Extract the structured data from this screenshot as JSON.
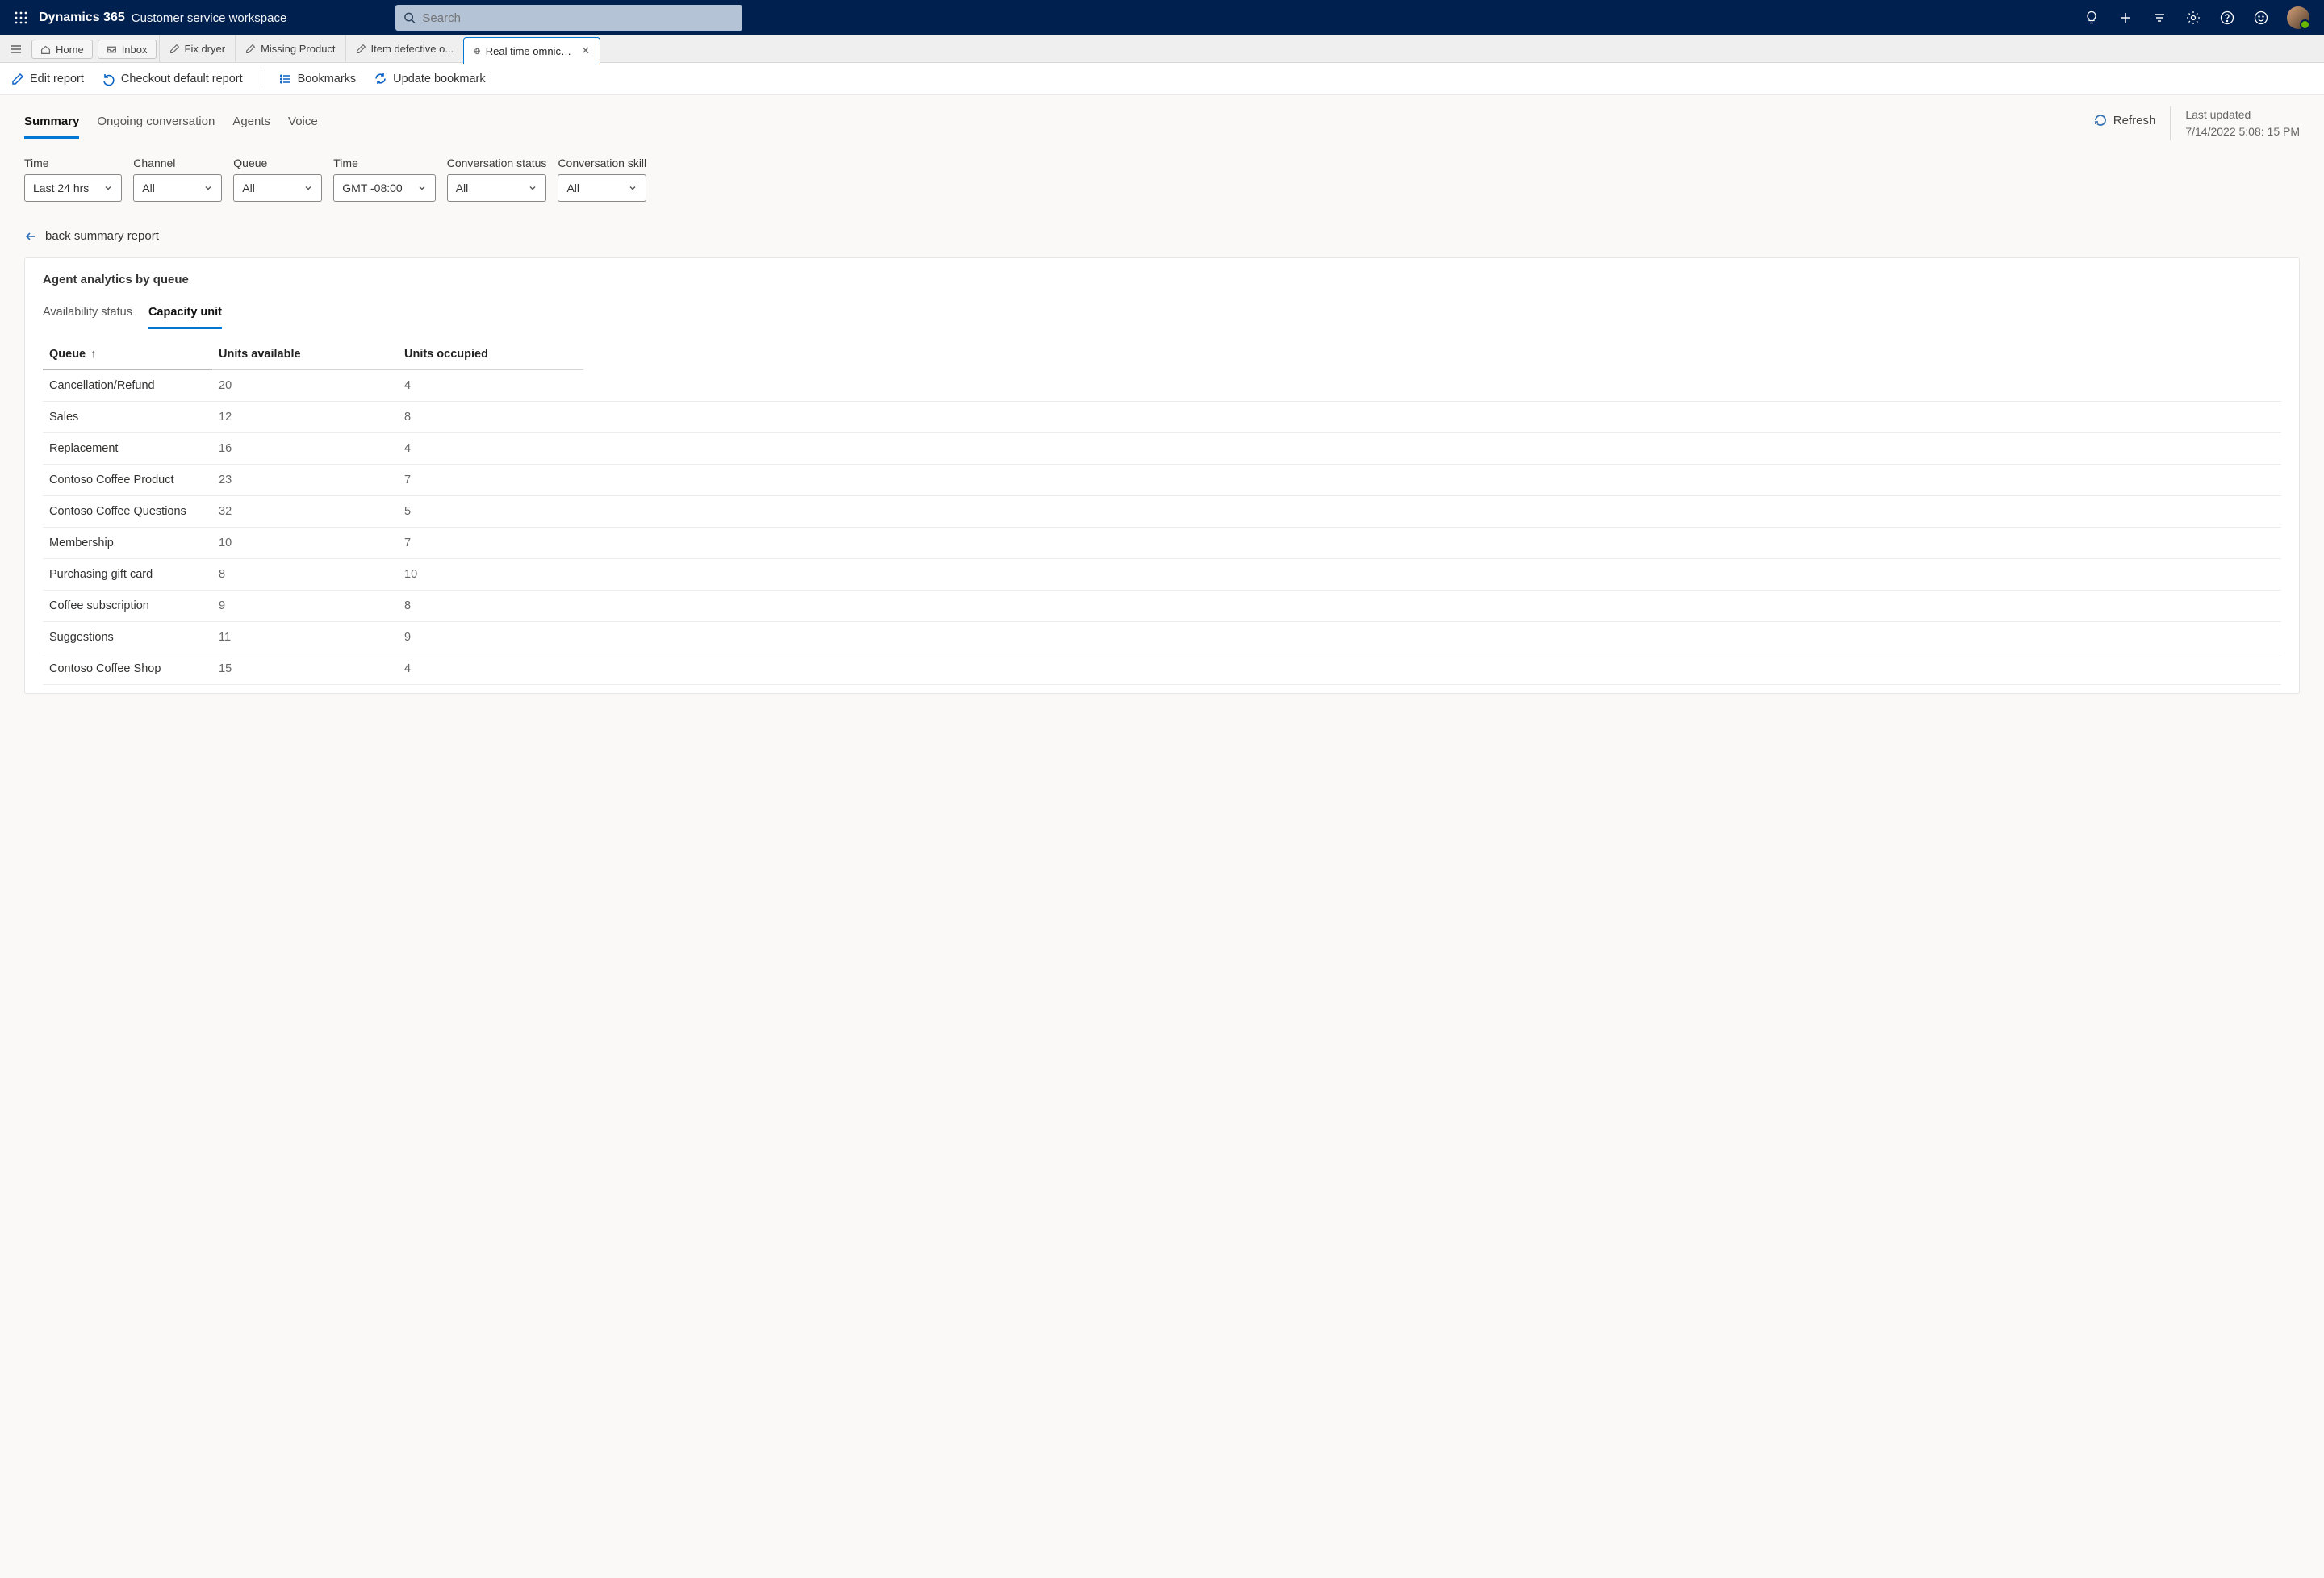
{
  "header": {
    "brand": "Dynamics 365",
    "workspace": "Customer service workspace",
    "search_placeholder": "Search"
  },
  "tabstrip": {
    "home": "Home",
    "inbox": "Inbox",
    "tabs": [
      {
        "label": "Fix dryer"
      },
      {
        "label": "Missing Product"
      },
      {
        "label": "Item defective o..."
      },
      {
        "label": "Real time omnichannel an...",
        "active": true,
        "closable": true
      }
    ]
  },
  "actions": {
    "edit_report": "Edit report",
    "checkout": "Checkout default report",
    "bookmarks": "Bookmarks",
    "update_bookmark": "Update bookmark"
  },
  "page_tabs": [
    "Summary",
    "Ongoing conversation",
    "Agents",
    "Voice"
  ],
  "page_tabs_active": 0,
  "refresh_label": "Refresh",
  "last_updated_label": "Last updated",
  "last_updated_value": "7/14/2022 5:08: 15 PM",
  "filters": [
    {
      "label": "Time",
      "value": "Last 24 hrs"
    },
    {
      "label": "Channel",
      "value": "All"
    },
    {
      "label": "Queue",
      "value": "All"
    },
    {
      "label": "Time",
      "value": "GMT -08:00"
    },
    {
      "label": "Conversation status",
      "value": "All"
    },
    {
      "label": "Conversation skill",
      "value": "All"
    }
  ],
  "back_link": "back summary report",
  "card": {
    "title": "Agent analytics by queue",
    "sub_tabs": [
      "Availability status",
      "Capacity unit"
    ],
    "sub_tabs_active": 1,
    "columns": {
      "queue": "Queue",
      "available": "Units available",
      "occupied": "Units occupied"
    },
    "rows": [
      {
        "queue": "Cancellation/Refund",
        "available": "20",
        "occupied": "4"
      },
      {
        "queue": "Sales",
        "available": "12",
        "occupied": "8"
      },
      {
        "queue": "Replacement",
        "available": "16",
        "occupied": "4"
      },
      {
        "queue": "Contoso Coffee Product",
        "available": "23",
        "occupied": "7"
      },
      {
        "queue": "Contoso Coffee Questions",
        "available": "32",
        "occupied": "5"
      },
      {
        "queue": "Membership",
        "available": "10",
        "occupied": "7"
      },
      {
        "queue": "Purchasing gift card",
        "available": "8",
        "occupied": "10"
      },
      {
        "queue": "Coffee subscription",
        "available": "9",
        "occupied": "8"
      },
      {
        "queue": "Suggestions",
        "available": "11",
        "occupied": "9"
      },
      {
        "queue": "Contoso Coffee Shop",
        "available": "15",
        "occupied": "4"
      }
    ]
  }
}
